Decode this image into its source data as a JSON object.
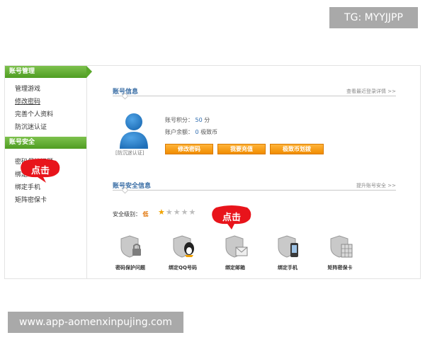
{
  "overlay": {
    "tg": "TG: MYYJJPP",
    "watermark": "www.app-aomenxinpujing.com"
  },
  "sidebar": {
    "account_header": "账号管理",
    "account_items": [
      {
        "label": "管理游戏"
      },
      {
        "label": "修改密码"
      },
      {
        "label": "完善个人资料"
      },
      {
        "label": "防沉迷认证"
      }
    ],
    "security_header": "账号安全",
    "security_items": [
      {
        "label": "密码保护问题"
      },
      {
        "label": "绑定邮箱"
      },
      {
        "label": "绑定手机"
      },
      {
        "label": "矩阵密保卡"
      }
    ],
    "click_bubble": "点击"
  },
  "account_info": {
    "title": "账号信息",
    "link": "查看最近登录详情 >>",
    "avatar_label": "[防沉迷认证]",
    "points_label": "账号积分：",
    "points_value": "50",
    "points_unit": "分",
    "balance_label": "账户余额：",
    "balance_value": "0",
    "balance_unit": "极致币",
    "buttons": [
      {
        "label": "修改密码"
      },
      {
        "label": "我要充值"
      },
      {
        "label": "极致币划拨"
      }
    ]
  },
  "security_info": {
    "title": "账号安全信息",
    "link": "提升账号安全 >>",
    "level_label": "安全级别：",
    "level_value": "低",
    "stars_filled": 1,
    "stars_total": 5,
    "click_bubble": "点击",
    "features": [
      {
        "label": "密码保护问题",
        "icon": "lock-shield-icon"
      },
      {
        "label": "绑定QQ号码",
        "icon": "penguin-shield-icon"
      },
      {
        "label": "绑定邮箱",
        "icon": "mail-shield-icon"
      },
      {
        "label": "绑定手机",
        "icon": "phone-shield-icon"
      },
      {
        "label": "矩阵密保卡",
        "icon": "card-shield-icon"
      }
    ]
  },
  "colors": {
    "sidebar_green": "#5aa82b",
    "button_orange": "#f39200",
    "title_blue": "#3a6ea5",
    "bubble_red": "#e8141b"
  }
}
